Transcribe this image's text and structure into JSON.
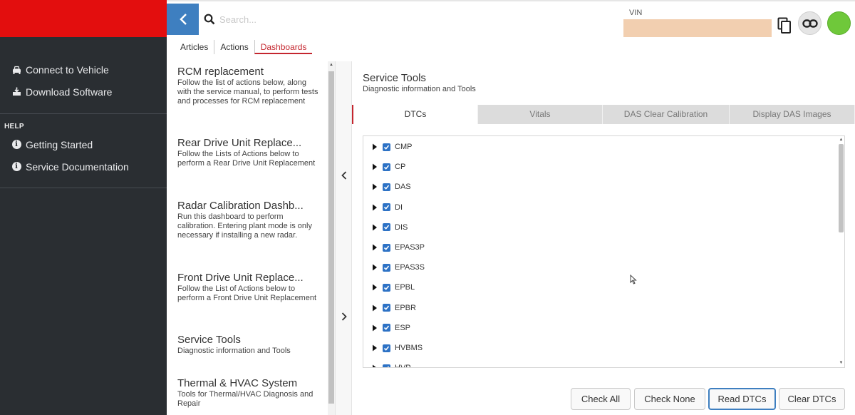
{
  "sidebar": {
    "items": [
      {
        "label": "Connect to Vehicle",
        "icon": "car-icon"
      },
      {
        "label": "Download Software",
        "icon": "download-icon"
      }
    ],
    "help_title": "HELP",
    "help_items": [
      {
        "label": "Getting Started",
        "icon": "info-icon"
      },
      {
        "label": "Service Documentation",
        "icon": "info-icon"
      }
    ],
    "brand_color": "#e30e0e"
  },
  "header": {
    "search_placeholder": "Search...",
    "vin_label": "VIN",
    "status_color": "#6fc83a"
  },
  "main_tabs": [
    {
      "label": "Articles"
    },
    {
      "label": "Actions"
    },
    {
      "label": "Dashboards",
      "active": true
    }
  ],
  "dashboards": [
    {
      "title": "RCM replacement",
      "description": "Follow the list of actions below, along with the service manual, to perform tests and processes for RCM replacement"
    },
    {
      "title": "Rear Drive Unit Replace...",
      "description": "Follow the Lists of Actions below to perform a Rear Drive Unit Replacement"
    },
    {
      "title": "Radar Calibration Dashb...",
      "description": "Run this dashboard to perform calibration. Entering plant mode is only necessary if installing a new radar."
    },
    {
      "title": "Front Drive Unit Replace...",
      "description": "Follow the List of Actions below to perform a Front Drive Unit Replacement"
    },
    {
      "title": "Service Tools",
      "description": "Diagnostic information and Tools"
    },
    {
      "title": "Thermal & HVAC System",
      "description": "Tools for Thermal/HVAC Diagnosis and Repair"
    }
  ],
  "panel": {
    "title": "Service Tools",
    "subtitle": "Diagnostic information and Tools",
    "tabs": [
      {
        "label": "DTCs",
        "active": true
      },
      {
        "label": "Vitals"
      },
      {
        "label": "DAS Clear Calibration"
      },
      {
        "label": "Display DAS Images"
      }
    ],
    "dtcs": [
      "CMP",
      "CP",
      "DAS",
      "DI",
      "DIS",
      "EPAS3P",
      "EPAS3S",
      "EPBL",
      "EPBR",
      "ESP",
      "HVBMS",
      "HVP"
    ],
    "buttons": {
      "check_all": "Check All",
      "check_none": "Check None",
      "read_dtcs": "Read DTCs",
      "clear_dtcs": "Clear DTCs"
    }
  },
  "accent_color": "#c4262e",
  "link_color": "#3e7fc0"
}
